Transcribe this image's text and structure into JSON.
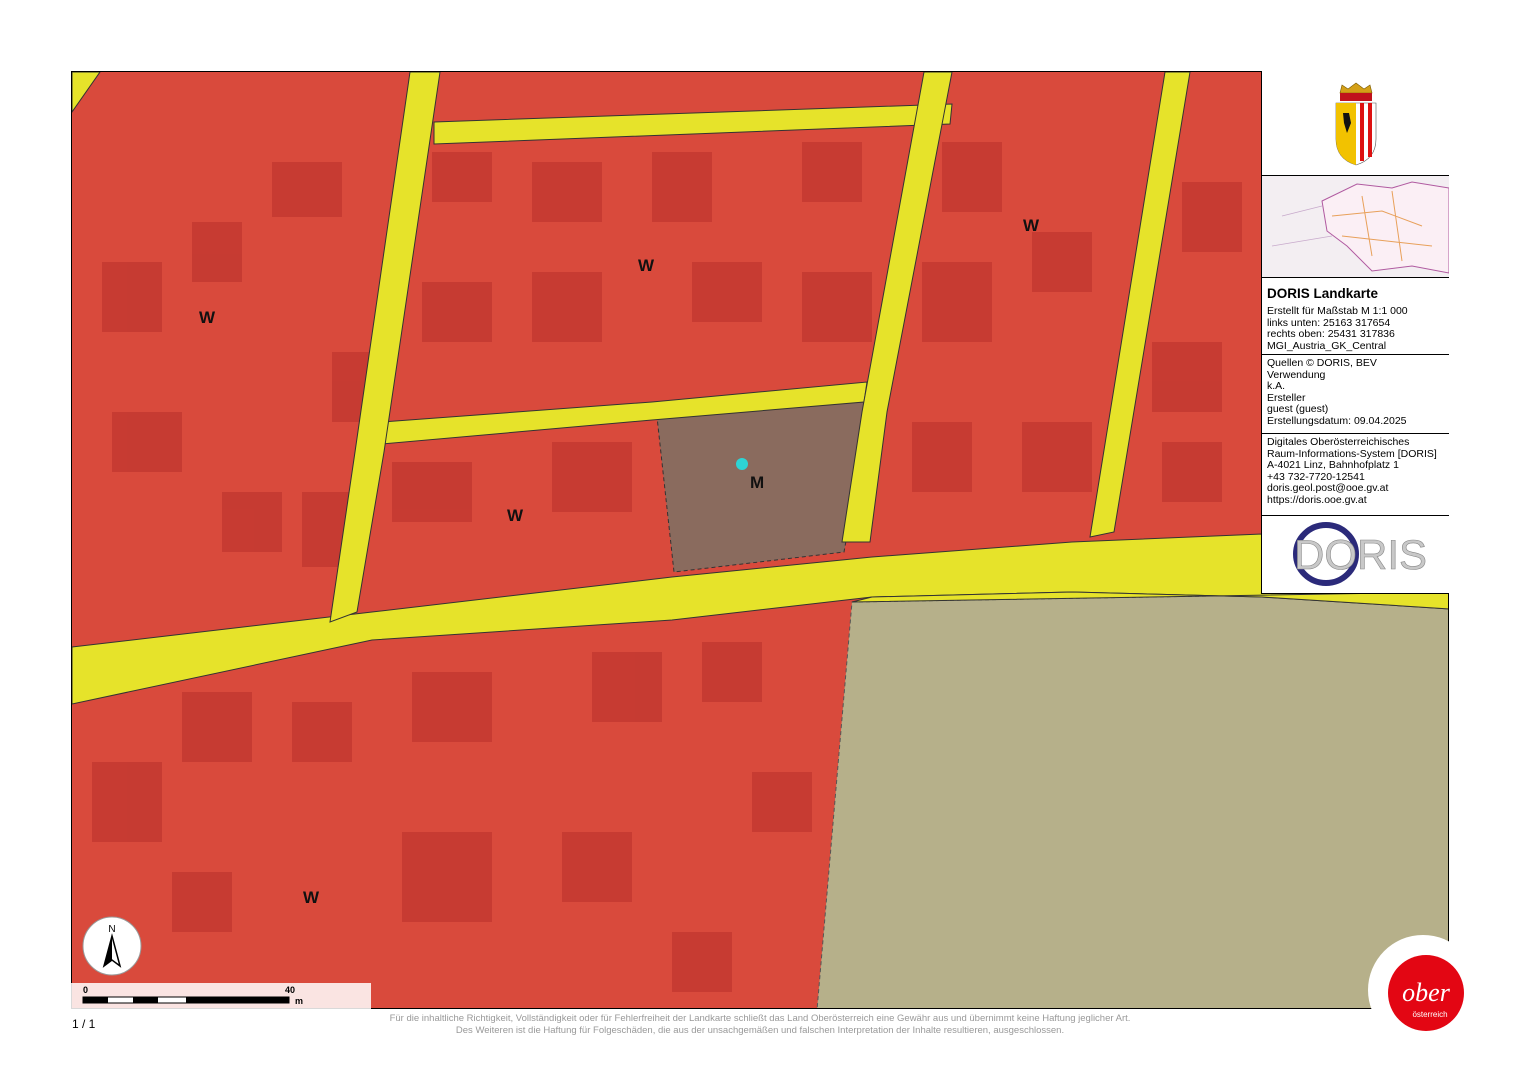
{
  "map": {
    "zone_labels": [
      {
        "code": "W"
      },
      {
        "code": "W"
      },
      {
        "code": "W"
      },
      {
        "code": "W"
      },
      {
        "code": "M"
      },
      {
        "code": "W"
      }
    ],
    "colors": {
      "residential_zone": "#d94a3c",
      "mixed_zone": "#8a6b5e",
      "road": "#e6e32a",
      "agricultural": "#b6b08a",
      "marker": "#2dd4d4"
    }
  },
  "panel": {
    "title": "DORIS Landkarte",
    "scale_line": "Erstellt für Maßstab M 1:1 000",
    "coord_lower_left": "links unten: 25163 317654",
    "coord_upper_right": "rechts oben: 25431 317836",
    "crs": "MGI_Austria_GK_Central",
    "sources": "Quellen © DORIS, BEV",
    "usage_label": "Verwendung",
    "usage_value": "k.A.",
    "creator_label": "Ersteller",
    "creator_value": "guest (guest)",
    "created_date": "Erstellungsdatum: 09.04.2025",
    "org_line1": "Digitales Oberösterreichisches",
    "org_line2": "Raum-Informations-System [DORIS]",
    "address": "A-4021 Linz, Bahnhofplatz 1",
    "phone": "+43 732-7720-12541",
    "email": "doris.geol.post@ooe.gv.at",
    "website": "https://doris.ooe.gv.at",
    "logo_text": "DORIS"
  },
  "scalebar": {
    "start": "0",
    "mid": "40",
    "unit": "m"
  },
  "north_arrow": {
    "letter": "N"
  },
  "page_number": "1 / 1",
  "disclaimer": {
    "line1": "Für die inhaltliche Richtigkeit, Vollständigkeit oder für Fehlerfreiheit der Landkarte schließt das Land Oberösterreich eine Gewähr aus und übernimmt keine Haftung jeglicher Art.",
    "line2": "Des Weiteren ist die Haftung für Folgeschäden, die aus der unsachgemäßen und falschen Interpretation der Inhalte resultieren, ausgeschlossen."
  },
  "badge": {
    "word": "ober",
    "sub": "österreich",
    "color": "#e30613"
  }
}
